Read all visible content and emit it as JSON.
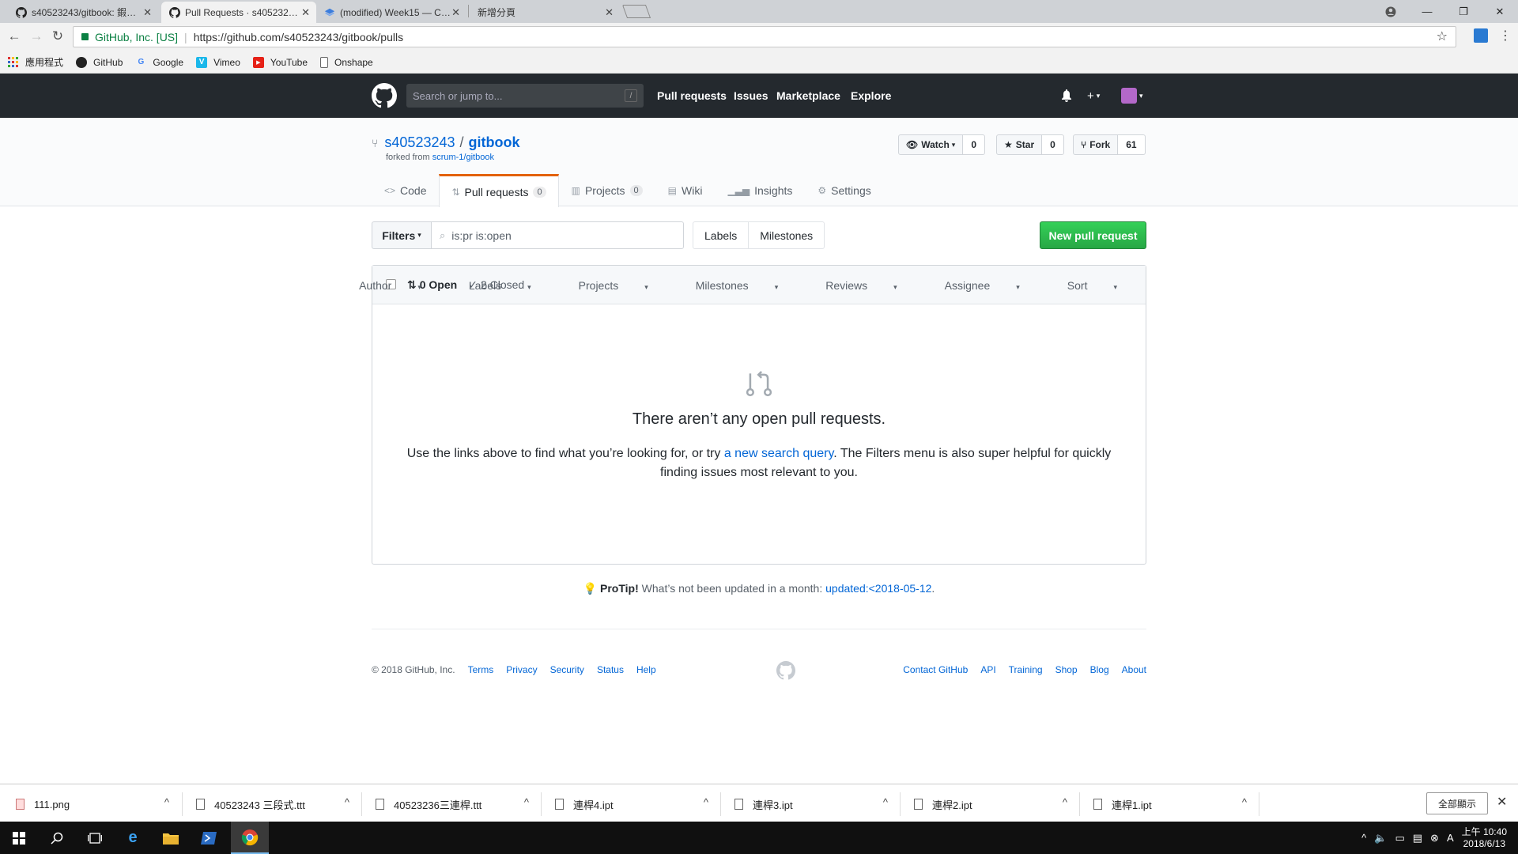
{
  "browser": {
    "tabs": [
      {
        "title": "s40523243/gitbook: 鍜…",
        "active": false
      },
      {
        "title": "Pull Requests · s405232…",
        "active": true
      },
      {
        "title": "(modified) Week15 — C…",
        "active": false
      },
      {
        "title": "新增分頁",
        "active": false
      }
    ],
    "secure_label": "GitHub, Inc. [US]",
    "url": "https://github.com/s40523243/gitbook/pulls",
    "bookmarks": [
      {
        "label": "應用程式",
        "icon": "apps-grid-icon"
      },
      {
        "label": "GitHub",
        "icon": "github-icon"
      },
      {
        "label": "Google",
        "icon": "google-icon"
      },
      {
        "label": "Vimeo",
        "icon": "vimeo-icon"
      },
      {
        "label": "YouTube",
        "icon": "youtube-icon"
      },
      {
        "label": "Onshape",
        "icon": "page-icon"
      }
    ]
  },
  "github": {
    "search_placeholder": "Search or jump to...",
    "search_key": "/",
    "nav": [
      "Pull requests",
      "Issues",
      "Marketplace",
      "Explore"
    ],
    "repo": {
      "owner": "s40523243",
      "separator": "/",
      "name": "gitbook",
      "forked_prefix": "forked from",
      "forked_from": "scrum-1/gitbook"
    },
    "actions": {
      "watch_label": "Watch",
      "watch_count": "0",
      "star_label": "Star",
      "star_count": "0",
      "fork_label": "Fork",
      "fork_count": "61"
    },
    "reponav": {
      "code": "Code",
      "pull_requests": "Pull requests",
      "pull_requests_count": "0",
      "projects": "Projects",
      "projects_count": "0",
      "wiki": "Wiki",
      "insights": "Insights",
      "settings": "Settings"
    },
    "subnav": {
      "filters_label": "Filters",
      "filter_query": "is:pr is:open",
      "labels": "Labels",
      "milestones": "Milestones",
      "new_pr": "New pull request"
    },
    "listing": {
      "open_label": "0 Open",
      "closed_label": "2 Closed",
      "menus": [
        "Author",
        "Labels",
        "Projects",
        "Milestones",
        "Reviews",
        "Assignee",
        "Sort"
      ]
    },
    "blankslate": {
      "title": "There aren’t any open pull requests.",
      "text_before": "Use the links above to find what you’re looking for, or try ",
      "link": "a new search query",
      "text_after": ". The Filters menu is also super helpful for quickly finding issues most relevant to you."
    },
    "protip": {
      "label": "ProTip!",
      "text": " What’s not been updated in a month: ",
      "link": "updated:<2018-05-12",
      "end": "."
    },
    "footer": {
      "copyright": "© 2018 GitHub, Inc.",
      "left_links": [
        "Terms",
        "Privacy",
        "Security",
        "Status",
        "Help"
      ],
      "right_links": [
        "Contact GitHub",
        "API",
        "Training",
        "Shop",
        "Blog",
        "About"
      ]
    }
  },
  "downloads": {
    "items": [
      "111.png",
      "40523243 三段式.ttt",
      "40523236三連桿.ttt",
      "連桿4.ipt",
      "連桿3.ipt",
      "連桿2.ipt",
      "連桿1.ipt"
    ],
    "show_all": "全部顯示"
  },
  "taskbar": {
    "time": "上午 10:40",
    "date": "2018/6/13"
  }
}
